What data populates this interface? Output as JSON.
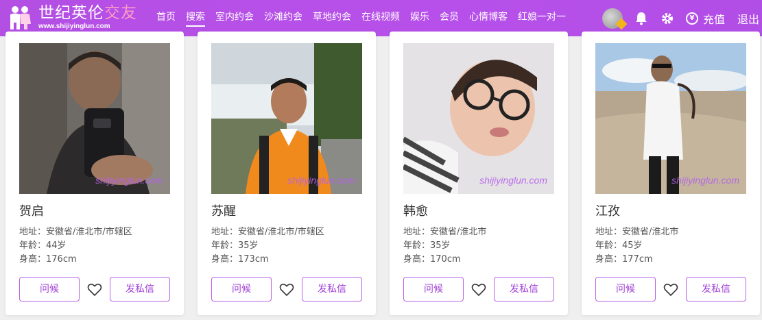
{
  "brand": {
    "name_part1": "世纪英伦",
    "name_part2": "交友",
    "url": "www.shijiyinglun.com"
  },
  "nav": {
    "items": [
      {
        "label": "首页",
        "active": false
      },
      {
        "label": "搜索",
        "active": true
      },
      {
        "label": "室内约会",
        "active": false
      },
      {
        "label": "沙滩约会",
        "active": false
      },
      {
        "label": "草地约会",
        "active": false
      },
      {
        "label": "在线视频",
        "active": false
      },
      {
        "label": "娱乐",
        "active": false
      },
      {
        "label": "会员",
        "active": false
      },
      {
        "label": "心情博客",
        "active": false
      },
      {
        "label": "红娘一对一",
        "active": false
      }
    ]
  },
  "toolbar": {
    "recharge_label": "充值",
    "coin_symbol": "¥",
    "logout_label": "退出"
  },
  "profiles": [
    {
      "name": "贺启",
      "address": "地址：安徽省/淮北市/市辖区",
      "age": "年龄：44岁",
      "height": "身高：176cm",
      "watermark": "shijiyinglun.com",
      "greet_label": "问候",
      "message_label": "发私信"
    },
    {
      "name": "苏醒",
      "address": "地址：安徽省/淮北市/市辖区",
      "age": "年龄：35岁",
      "height": "身高：173cm",
      "watermark": "shijiyinglun.com",
      "greet_label": "问候",
      "message_label": "发私信"
    },
    {
      "name": "韩愈",
      "address": "地址：安徽省/淮北市",
      "age": "年龄：35岁",
      "height": "身高：170cm",
      "watermark": "shijiyinglun.com",
      "greet_label": "问候",
      "message_label": "发私信"
    },
    {
      "name": "江孜",
      "address": "地址：安徽省/淮北市",
      "age": "年龄：45岁",
      "height": "身高：177cm",
      "watermark": "shijiyinglun.com",
      "greet_label": "问候",
      "message_label": "发私信"
    }
  ],
  "colors": {
    "header": "#b44fe4",
    "accent": "#b961e6",
    "watermark": "#b562eb"
  }
}
